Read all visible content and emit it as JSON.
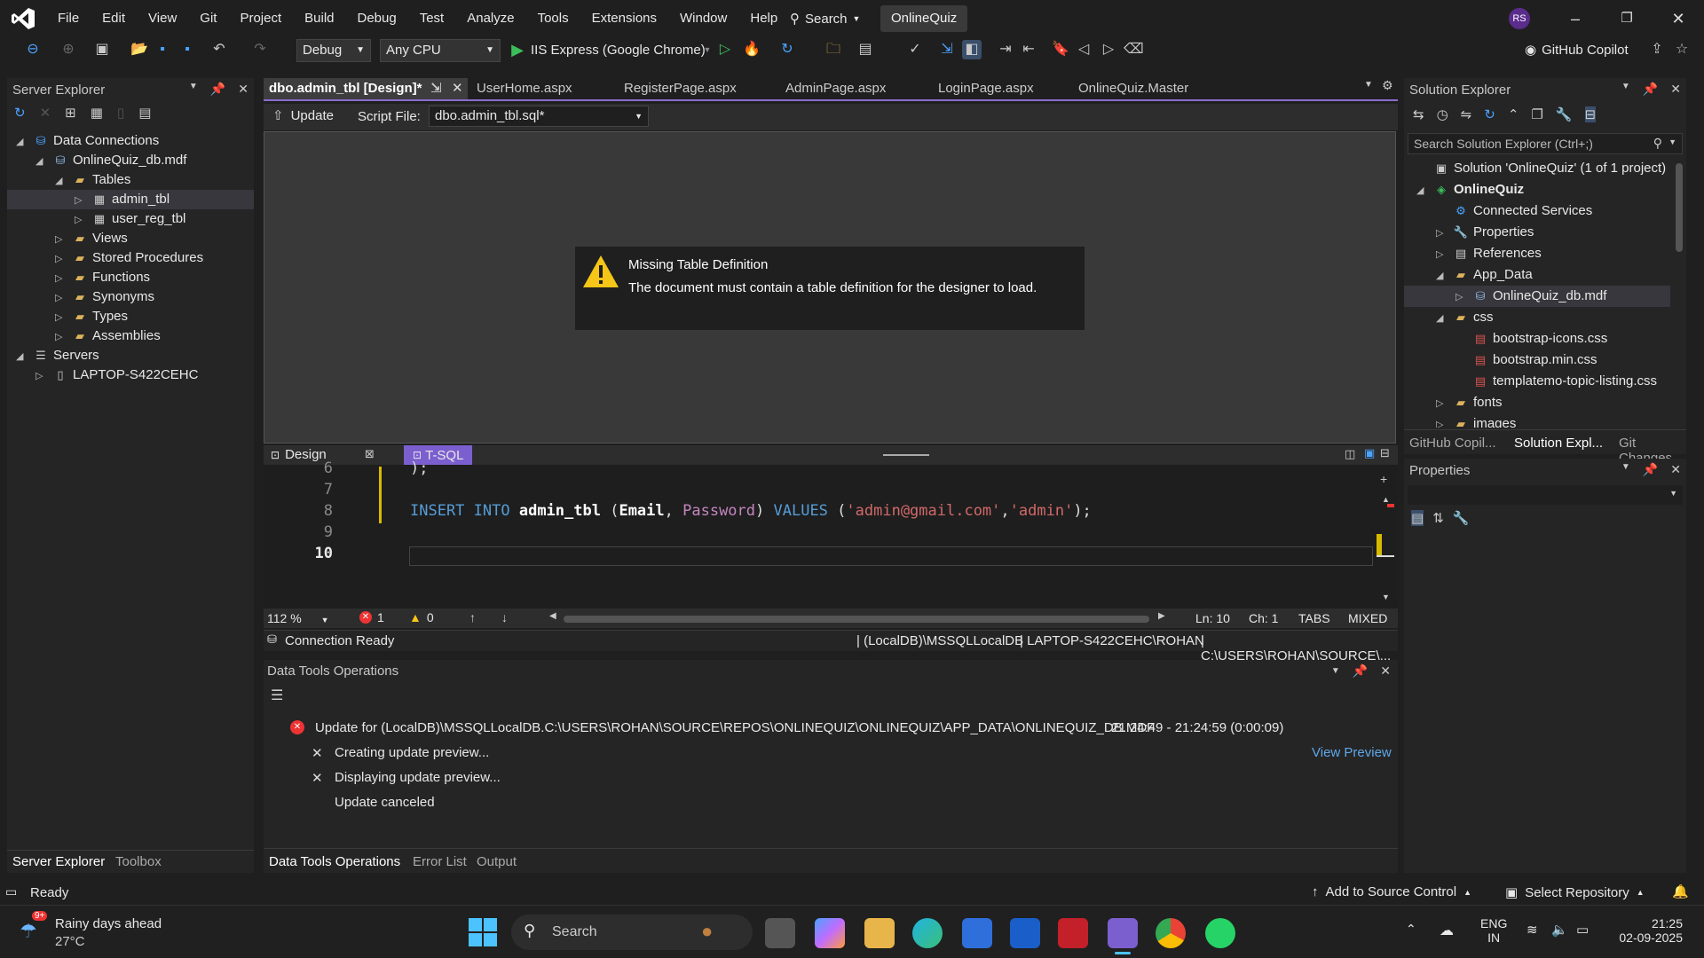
{
  "menubar": {
    "items": [
      "File",
      "Edit",
      "View",
      "Git",
      "Project",
      "Build",
      "Debug",
      "Test",
      "Analyze",
      "Tools",
      "Extensions",
      "Window",
      "Help"
    ],
    "search_label": "Search",
    "solution_name": "OnlineQuiz",
    "avatar": "RS"
  },
  "toolbar": {
    "config": "Debug",
    "platform": "Any CPU",
    "run_target": "IIS Express (Google Chrome)",
    "copilot": "GitHub Copilot"
  },
  "server_explorer": {
    "title": "Server Explorer",
    "tree": [
      {
        "label": "Data Connections",
        "level": 0,
        "expanded": true,
        "icon": "data-connections-icon"
      },
      {
        "label": "OnlineQuiz_db.mdf",
        "level": 1,
        "expanded": true,
        "icon": "database-icon"
      },
      {
        "label": "Tables",
        "level": 2,
        "expanded": true,
        "icon": "folder-icon"
      },
      {
        "label": "admin_tbl",
        "level": 3,
        "expanded": false,
        "icon": "table-icon",
        "selected": true
      },
      {
        "label": "user_reg_tbl",
        "level": 3,
        "expanded": false,
        "icon": "table-icon"
      },
      {
        "label": "Views",
        "level": 2,
        "expanded": false,
        "icon": "folder-icon"
      },
      {
        "label": "Stored Procedures",
        "level": 2,
        "expanded": false,
        "icon": "folder-icon"
      },
      {
        "label": "Functions",
        "level": 2,
        "expanded": false,
        "icon": "folder-icon"
      },
      {
        "label": "Synonyms",
        "level": 2,
        "expanded": false,
        "icon": "folder-icon"
      },
      {
        "label": "Types",
        "level": 2,
        "expanded": false,
        "icon": "folder-icon"
      },
      {
        "label": "Assemblies",
        "level": 2,
        "expanded": false,
        "icon": "folder-icon"
      },
      {
        "label": "Servers",
        "level": 0,
        "expanded": true,
        "icon": "servers-icon"
      },
      {
        "label": "LAPTOP-S422CEHC",
        "level": 1,
        "expanded": false,
        "icon": "computer-icon"
      }
    ],
    "bottom_tabs": [
      "Server Explorer",
      "Toolbox"
    ]
  },
  "doc_tabs": [
    "dbo.admin_tbl [Design]*",
    "UserHome.aspx",
    "RegisterPage.aspx",
    "AdminPage.aspx",
    "LoginPage.aspx",
    "OnlineQuiz.Master"
  ],
  "designer": {
    "update_label": "Update",
    "script_file_label": "Script File:",
    "script_file_value": "dbo.admin_tbl.sql*",
    "message_title": "Missing Table Definition",
    "message_body": "The document must contain a table definition for the designer to load.",
    "design_tab": "Design",
    "tsql_tab": "T-SQL"
  },
  "code": {
    "lines": [
      {
        "num": "6",
        "text": ");"
      },
      {
        "num": "7",
        "text": ""
      },
      {
        "num": "8",
        "text": "INSERT INTO admin_tbl (Email, Password) VALUES ('admin@gmail.com','admin');"
      },
      {
        "num": "9",
        "text": ""
      },
      {
        "num": "10",
        "text": ""
      }
    ],
    "kw_insert": "INSERT INTO",
    "table": "admin_tbl",
    "col1": "Email",
    "col2": "Password",
    "kw_values": "VALUES",
    "str1": "'admin@gmail.com'",
    "str2": "'admin'"
  },
  "editor_status": {
    "zoom": "112 %",
    "errors": "1",
    "warnings": "0",
    "ln": "Ln: 10",
    "ch": "Ch: 1",
    "tabs": "TABS",
    "mixed": "MIXED"
  },
  "connection": {
    "status": "Connection Ready",
    "server": "(LocalDB)\\MSSQLLocalDB",
    "user": "LAPTOP-S422CEHC\\ROHAN",
    "path": "C:\\USERS\\ROHAN\\SOURCE\\..."
  },
  "dto": {
    "title": "Data Tools Operations",
    "entry": "Update for (LocalDB)\\MSSQLLocalDB.C:\\USERS\\ROHAN\\SOURCE\\REPOS\\ONLINEQUIZ\\ONLINEQUIZ\\APP_DATA\\ONLINEQUIZ_DB.MDF",
    "time": "21:24:49 - 21:24:59 (0:00:09)",
    "sub1": "Creating update preview...",
    "sub2": "Displaying update preview...",
    "sub3": "Update canceled",
    "view_preview": "View Preview",
    "bottom_tabs": [
      "Data Tools Operations",
      "Error List",
      "Output"
    ]
  },
  "solution_explorer": {
    "title": "Solution Explorer",
    "search_placeholder": "Search Solution Explorer (Ctrl+;)",
    "tree": [
      {
        "label": "Solution 'OnlineQuiz' (1 of 1 project)",
        "level": 0,
        "arrow": "",
        "icon": "solution-icon"
      },
      {
        "label": "OnlineQuiz",
        "level": 0,
        "arrow": "open",
        "icon": "web-project-icon",
        "bold": true
      },
      {
        "label": "Connected Services",
        "level": 1,
        "arrow": "",
        "icon": "connected-services-icon"
      },
      {
        "label": "Properties",
        "level": 1,
        "arrow": "closed",
        "icon": "wrench-icon"
      },
      {
        "label": "References",
        "level": 1,
        "arrow": "closed",
        "icon": "references-icon"
      },
      {
        "label": "App_Data",
        "level": 1,
        "arrow": "open",
        "icon": "folder-icon"
      },
      {
        "label": "OnlineQuiz_db.mdf",
        "level": 2,
        "arrow": "closed",
        "icon": "database-icon",
        "selected": true
      },
      {
        "label": "css",
        "level": 1,
        "arrow": "open",
        "icon": "folder-icon"
      },
      {
        "label": "bootstrap-icons.css",
        "level": 2,
        "arrow": "",
        "icon": "css-file-icon"
      },
      {
        "label": "bootstrap.min.css",
        "level": 2,
        "arrow": "",
        "icon": "css-file-icon"
      },
      {
        "label": "templatemo-topic-listing.css",
        "level": 2,
        "arrow": "",
        "icon": "css-file-icon"
      },
      {
        "label": "fonts",
        "level": 1,
        "arrow": "closed",
        "icon": "folder-icon"
      },
      {
        "label": "images",
        "level": 1,
        "arrow": "closed",
        "icon": "folder-icon"
      }
    ],
    "bottom_tabs": [
      "GitHub Copil...",
      "Solution Expl...",
      "Git Changes"
    ]
  },
  "properties": {
    "title": "Properties"
  },
  "statusbar": {
    "ready": "Ready",
    "add_source": "Add to Source Control",
    "select_repo": "Select Repository"
  },
  "taskbar": {
    "weather_title": "Rainy days ahead",
    "weather_temp": "27°C",
    "weather_badge": "9+",
    "search": "Search",
    "lang1": "ENG",
    "lang2": "IN",
    "time": "21:25",
    "date": "02-09-2025"
  }
}
